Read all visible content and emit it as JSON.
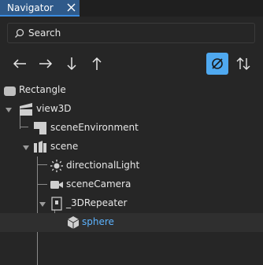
{
  "tab": {
    "label": "Navigator"
  },
  "search": {
    "placeholder": "Search"
  },
  "toolbar": {
    "buttons": [
      "arrow-left",
      "arrow-right",
      "arrow-down",
      "arrow-up"
    ],
    "filter_active": true
  },
  "tree": {
    "items": [
      {
        "label": "Rectangle"
      },
      {
        "label": "view3D"
      },
      {
        "label": "sceneEnvironment"
      },
      {
        "label": "scene"
      },
      {
        "label": "directionalLight"
      },
      {
        "label": "sceneCamera"
      },
      {
        "label": "_3DRepeater"
      },
      {
        "label": "sphere"
      }
    ]
  },
  "colors": {
    "background": "#262626",
    "tab_active": "#2f5a8a",
    "accent": "#4fa9f0",
    "selected_text": "#5cb3ff"
  }
}
